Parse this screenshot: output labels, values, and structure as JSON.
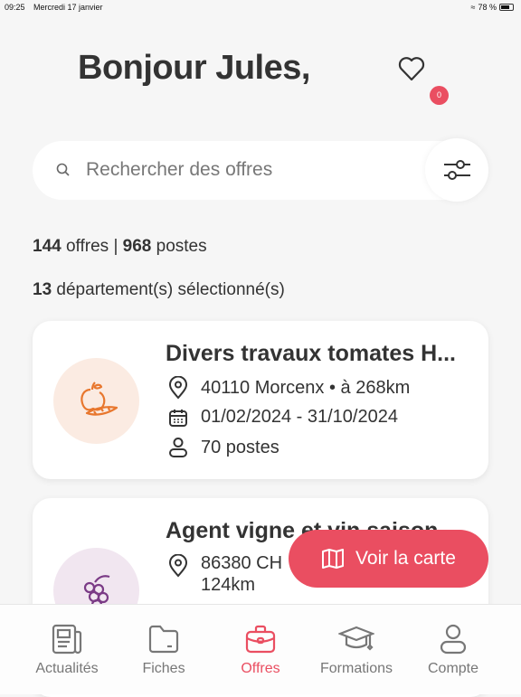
{
  "status": {
    "time": "09:25",
    "date": "Mercredi 17 janvier",
    "battery": "78 %"
  },
  "header": {
    "greeting": "Bonjour Jules,",
    "favorites_count": "0"
  },
  "search": {
    "placeholder": "Rechercher des offres"
  },
  "stats": {
    "offers": "144",
    "offers_label": "offres |",
    "posts": "968",
    "posts_label": "postes",
    "departments": "13",
    "departments_label": "département(s) sélectionné(s)"
  },
  "offers": [
    {
      "title": "Divers travaux tomates H...",
      "location": "40110 Morcenx",
      "distance": "à 268km",
      "dates": "01/02/2024 - 31/10/2024",
      "posts": "70 postes",
      "icon": "fruit-vegetable-icon",
      "color": "#e8772e"
    },
    {
      "title": "Agent vigne et vin saison",
      "location": "86380 CH",
      "distance": "124km",
      "icon": "grapes-icon",
      "color": "#7b3b86"
    }
  ],
  "map_button": "Voir la carte",
  "nav": [
    {
      "label": "Actualités"
    },
    {
      "label": "Fiches"
    },
    {
      "label": "Offres",
      "active": true
    },
    {
      "label": "Formations"
    },
    {
      "label": "Compte"
    }
  ],
  "colors": {
    "accent": "#ea4e61"
  }
}
